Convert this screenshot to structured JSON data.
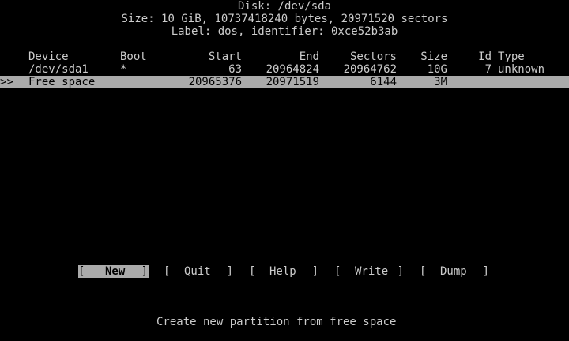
{
  "header": {
    "disk": "Disk: /dev/sda",
    "size": "Size: 10 GiB, 10737418240 bytes, 20971520 sectors",
    "label": "Label: dos, identifier: 0xce52b3ab"
  },
  "table": {
    "columns": {
      "device": "Device",
      "boot": "Boot",
      "start": "Start",
      "end": "End",
      "sectors": "Sectors",
      "size": "Size",
      "id": "Id",
      "type": "Type"
    },
    "rows": [
      {
        "marker": "",
        "device": "/dev/sda1",
        "boot": "*",
        "start": "63",
        "end": "20964824",
        "sectors": "20964762",
        "size": "10G",
        "id": "7",
        "type": "unknown",
        "selected": false
      },
      {
        "marker": ">>",
        "device": "Free space",
        "boot": "",
        "start": "20965376",
        "end": "20971519",
        "sectors": "6144",
        "size": "3M",
        "id": "",
        "type": "",
        "selected": true
      }
    ]
  },
  "menu": {
    "new": {
      "open": "[",
      "label": "New",
      "close": "]"
    },
    "quit": {
      "open": "[",
      "label": "Quit",
      "close": "]"
    },
    "help": {
      "open": "[",
      "label": "Help",
      "close": "]"
    },
    "write": {
      "open": "[",
      "label": "Write",
      "close": "]"
    },
    "dump": {
      "open": "[",
      "label": "Dump",
      "close": "]"
    }
  },
  "status": "Create new partition from free space",
  "colors": {
    "background": "#000000",
    "text": "#cccccc",
    "selection_background": "#aaaaaa",
    "selection_text": "#000000"
  }
}
